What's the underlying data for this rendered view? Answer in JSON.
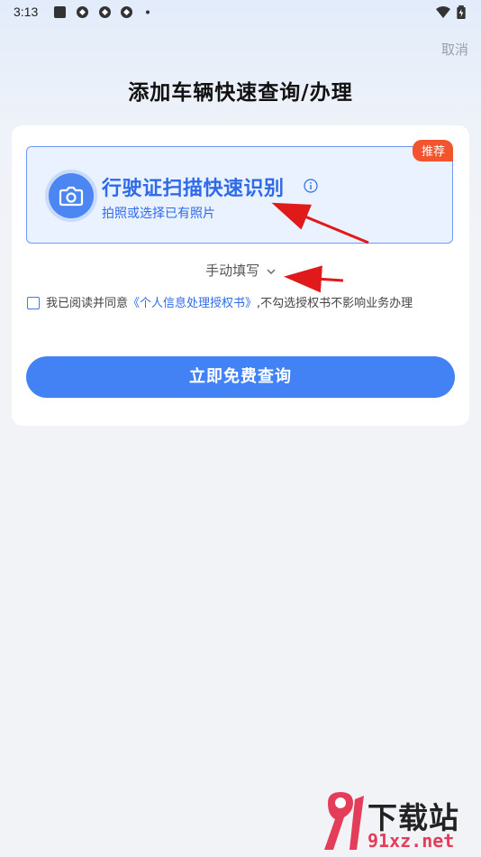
{
  "status_bar": {
    "time": "3:13"
  },
  "header": {
    "cancel_label": "取消",
    "title": "添加车辆快速查询/办理"
  },
  "scan_card": {
    "badge": "推荐",
    "title": "行驶证扫描快速识别",
    "subtitle": "拍照或选择已有照片",
    "icons": [
      "camera-icon",
      "info-icon"
    ]
  },
  "manual_entry": {
    "label": "手动填写"
  },
  "agreement": {
    "prefix": "我已阅读并同意",
    "link": "《个人信息处理授权书》",
    "suffix": ",不勾选授权书不影响业务办理",
    "checked": false
  },
  "query_button": {
    "label": "立即免费查询"
  },
  "watermark": {
    "brand": "下载站",
    "url": "91xz.net",
    "logo_text": "91"
  },
  "colors": {
    "accent": "#4282f5",
    "badge": "#f2542d",
    "annotation_arrow": "#e01a1a"
  }
}
